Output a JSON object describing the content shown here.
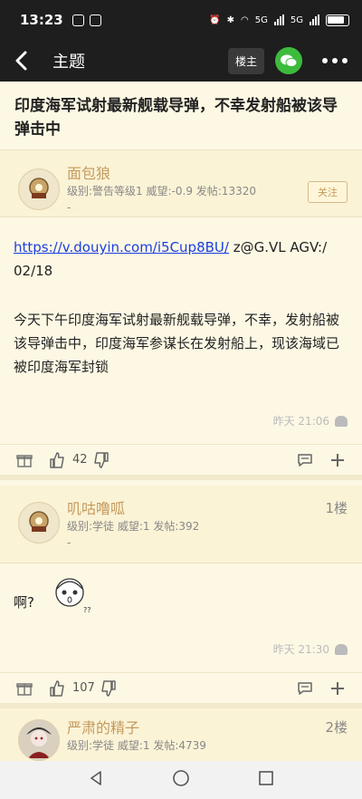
{
  "status_bar": {
    "time": "13:23",
    "network": "5G",
    "battery": "80"
  },
  "header": {
    "back_label": "主题",
    "owner_label": "楼主"
  },
  "thread": {
    "title": "印度海军试射最新舰载导弹，不幸发射船被该导弹击中"
  },
  "posts": [
    {
      "username": "面包狼",
      "info": "级别:警告等级1 威望:-0.9 发帖:13320",
      "info_dash": "-",
      "follow_label": "关注",
      "link": "https://v.douyin.com/i5Cup8BU/",
      "link_suffix": " z@G.VL AGV:/ 02/18",
      "body": "今天下午印度海军试射最新舰载导弹，不幸，发射船被该导弹击中，印度海军参谋长在发射船上，现该海域已被印度海军封锁",
      "time": "昨天 21:06",
      "likes": "42"
    },
    {
      "username": "叽咕噜呱",
      "info": "级别:学徒 威望:1 发帖:392",
      "info_dash": "-",
      "floor": "1楼",
      "body": "啊?",
      "time": "昨天 21:30",
      "likes": "107"
    },
    {
      "username": "严肃的精子",
      "info": "级别:学徒 威望:1 发帖:4739",
      "floor": "2楼"
    }
  ]
}
